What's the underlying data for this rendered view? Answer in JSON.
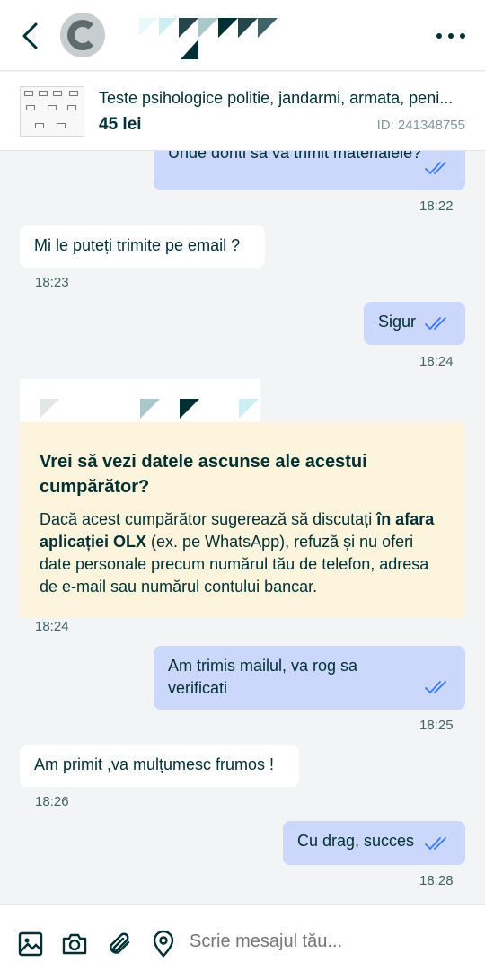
{
  "header": {
    "back_icon": "chevron-left-icon",
    "avatar_icon": "user-avatar",
    "logo_icon": "olx-pattern-logo",
    "menu_icon": "more-horizontal-icon"
  },
  "ad": {
    "title": "Teste psihologice politie, jandarmi, armata, peni...",
    "price": "45 lei",
    "id": "ID: 241348755"
  },
  "messages": [
    {
      "dir": "out",
      "text": "Unde doriti sa va trimit materialele?",
      "time": "18:22"
    },
    {
      "dir": "in",
      "text": "Mi le puteți trimite pe email ?",
      "time": "18:23"
    },
    {
      "dir": "out",
      "text": "Sigur",
      "time": "18:24"
    },
    {
      "dir": "out",
      "text": "Am trimis mailul, va rog sa verificati",
      "time": "18:25"
    },
    {
      "dir": "in",
      "text": "Am primit ,va mulțumesc frumos !",
      "time": "18:26"
    },
    {
      "dir": "out",
      "text": "Cu drag, succes",
      "time": "18:28"
    }
  ],
  "warning": {
    "title": "Vrei să vezi datele ascunse ale acestui cumpărător?",
    "text_before": "Dacă acest cumpărător sugerează să discutați ",
    "text_bold": "în afara aplicației OLX",
    "text_after": " (ex. pe WhatsApp), refuză și nu oferi date personale precum numărul tău de telefon, adresa de e-mail sau numărul contului bancar.",
    "time": "18:24"
  },
  "composer": {
    "placeholder": "Scrie mesajul tău...",
    "icons": [
      "image-icon",
      "camera-icon",
      "attachment-icon",
      "location-icon"
    ]
  },
  "colors": {
    "outgoing_bubble": "#cbd8fc",
    "incoming_bubble": "#ffffff",
    "warning_bg": "#fdf4dd",
    "text": "#002f34",
    "read_ticks": "#3a77ff"
  }
}
